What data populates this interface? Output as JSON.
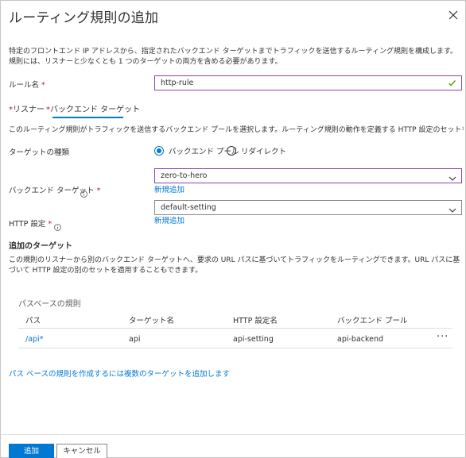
{
  "header": {
    "title": "ルーティング規則の追加",
    "close_icon": "close-icon"
  },
  "intro": "特定のフロントエンド IP アドレスから、指定されたバックエンド ターゲットまでトラフィックを送信するルーティング規則を構成します。規則には、リスナーと少なくとも 1 つのターゲットの両方を含める必要があります。",
  "rule_name": {
    "label": "ルール名",
    "required_mark": "*",
    "value": "http-rule"
  },
  "tabs": [
    {
      "label": "リスナー",
      "required_mark": "*",
      "selected": false
    },
    {
      "label": "バックエンド ターゲット",
      "required_mark": "*",
      "selected": true
    }
  ],
  "backend_description": "このルーティング規則がトラフィックを送信するバックエンド プールを選択します。ルーティング規則の動作を定義する HTTP 設定のセットを指定する必要もあります。",
  "target_type": {
    "label": "ターゲットの種類",
    "options": [
      "バックエンド プール",
      "リダイレクト"
    ],
    "selected": "バックエンド プール"
  },
  "backend_target": {
    "label": "バックエンド ターゲット",
    "required_mark": "*",
    "value": "zero-to-hero",
    "add_link": "新規追加"
  },
  "http_setting": {
    "label": "HTTP 設定",
    "required_mark": "*",
    "value": "default-setting",
    "add_link": "新規追加"
  },
  "additional_targets": {
    "title": "追加のターゲット",
    "description": "この規則のリスナーから別のバックエンド ターゲットへ、要求の URL パスに基づいてトラフィックをルーティングできます。URL パスに基づいて HTTP 設定の別のセットを適用することもできます。"
  },
  "path_rules": {
    "title": "パスベースの規則",
    "columns": [
      "パス",
      "ターゲット名",
      "HTTP 設定名",
      "バックエンド プール"
    ],
    "rows": [
      {
        "path": "/api*",
        "target": "api",
        "http_setting": "api-setting",
        "backend_pool": "api-backend",
        "more": "···"
      }
    ],
    "footer_link": "パス ベースの規則を作成するには複数のターゲットを追加します"
  },
  "footer": {
    "add_button": "追加",
    "cancel_button": "キャンセル"
  },
  "colors": {
    "accent": "#0078d4",
    "focus_border": "#8b41b0",
    "valid_check": "#57a300",
    "required": "#a4262c"
  }
}
